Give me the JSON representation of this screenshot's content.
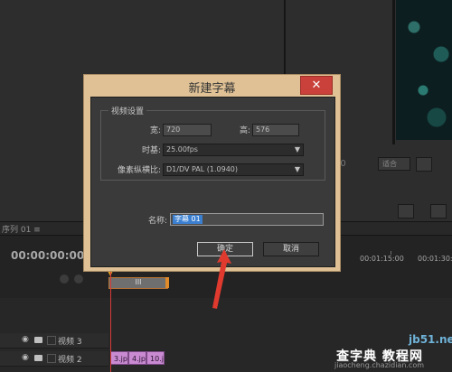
{
  "dialog": {
    "title": "新建字幕",
    "close_glyph": "✕",
    "group_label": "视频设置",
    "width_label": "宽:",
    "width_value": "720",
    "height_label": "高:",
    "height_value": "576",
    "timebase_label": "时基:",
    "timebase_value": "25.00fps",
    "pixel_aspect_label": "像素纵横比:",
    "pixel_aspect_value": "D1/DV PAL (1.0940)",
    "name_label": "名称:",
    "name_value": "字幕 01",
    "ok_label": "确定",
    "cancel_label": "取消"
  },
  "background": {
    "sequence_tab": "序列 01 ≡",
    "sequence_timecode": "00:00:00:00",
    "monitor_timecode": "00",
    "fit_label": "适合",
    "ruler": [
      "00:01:15:00",
      "00:01:30:00"
    ],
    "work_area_marker": "III",
    "tracks": [
      {
        "name": "视频 3"
      },
      {
        "name": "视频 2"
      }
    ],
    "clips": [
      "3.jp",
      "4.jp",
      "10.j"
    ]
  },
  "watermark": {
    "site": "jb51.net",
    "text": "查字典 教程网",
    "url": "jiaocheng.chazidian.com"
  },
  "colors": {
    "dialog_frame": "#dfc195",
    "dialog_body": "#3a3a3a",
    "close_button": "#c9413a",
    "selection": "#3b7fd1",
    "arrow": "#e03a2f",
    "clip": "#c98ad1"
  }
}
